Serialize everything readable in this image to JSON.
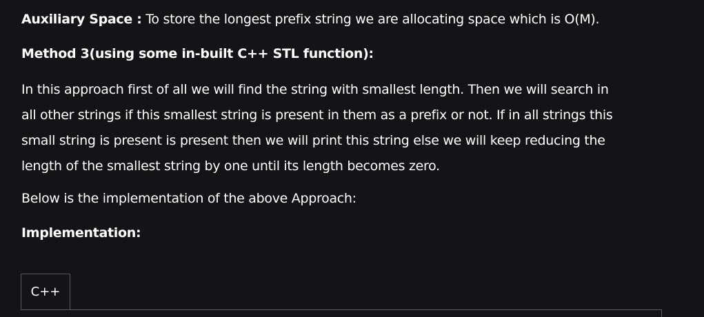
{
  "article": {
    "aux_space": {
      "label": "Auxiliary Space :",
      "text": " To store the longest prefix string we are allocating space which is O(M)."
    },
    "method3_heading": "Method 3(using some in-built C++ STL function):",
    "approach_lines": [
      " In this approach first of all we will find the string with smallest length. Then we will search in",
      "all other strings if this smallest string is present in them as a prefix or not. If in all strings this",
      "small string is present is present then we will print this string else we will keep reducing the",
      "length of the smallest string by one until its length becomes zero."
    ],
    "below_text": "Below is the implementation of the above Approach:",
    "implementation_heading": "Implementation:"
  },
  "code_tabs": {
    "tabs": [
      "C++"
    ],
    "active": "C++"
  }
}
